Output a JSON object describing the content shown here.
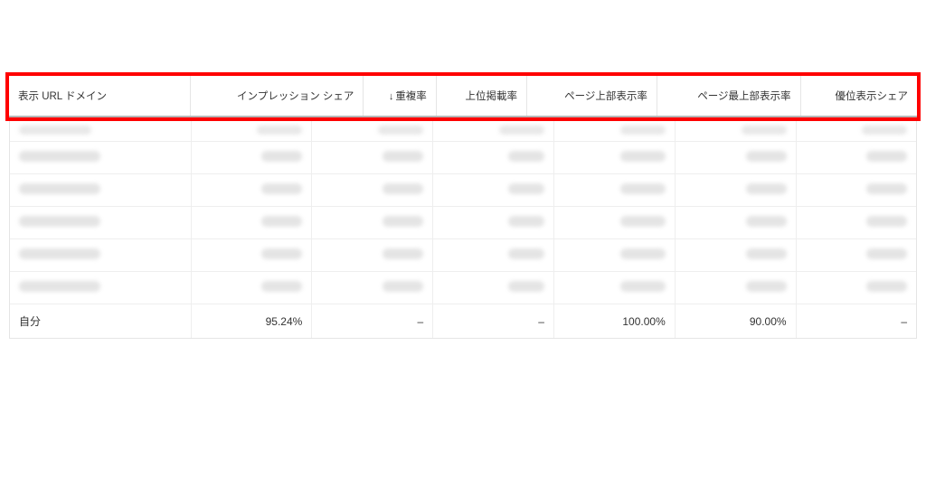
{
  "table": {
    "columns": [
      {
        "label": "表示 URL ドメイン",
        "align": "left",
        "sorted": false
      },
      {
        "label": "インプレッション シェア",
        "align": "right",
        "sorted": false
      },
      {
        "label": "重複率",
        "align": "right",
        "sorted": true,
        "sortDir": "desc"
      },
      {
        "label": "上位掲載率",
        "align": "right",
        "sorted": false
      },
      {
        "label": "ページ上部表示率",
        "align": "right",
        "sorted": false
      },
      {
        "label": "ページ最上部表示率",
        "align": "right",
        "sorted": false
      },
      {
        "label": "優位表示シェア",
        "align": "right",
        "sorted": false
      }
    ],
    "blurredRowCount": 5,
    "footerRow": {
      "domain": "自分",
      "impressionShare": "95.24%",
      "overlapRate": "–",
      "positionAboveRate": "–",
      "topOfPageRate": "100.00%",
      "absTopOfPageRate": "90.00%",
      "outrankingShare": "–"
    }
  },
  "icons": {
    "sortDesc": "↓"
  }
}
